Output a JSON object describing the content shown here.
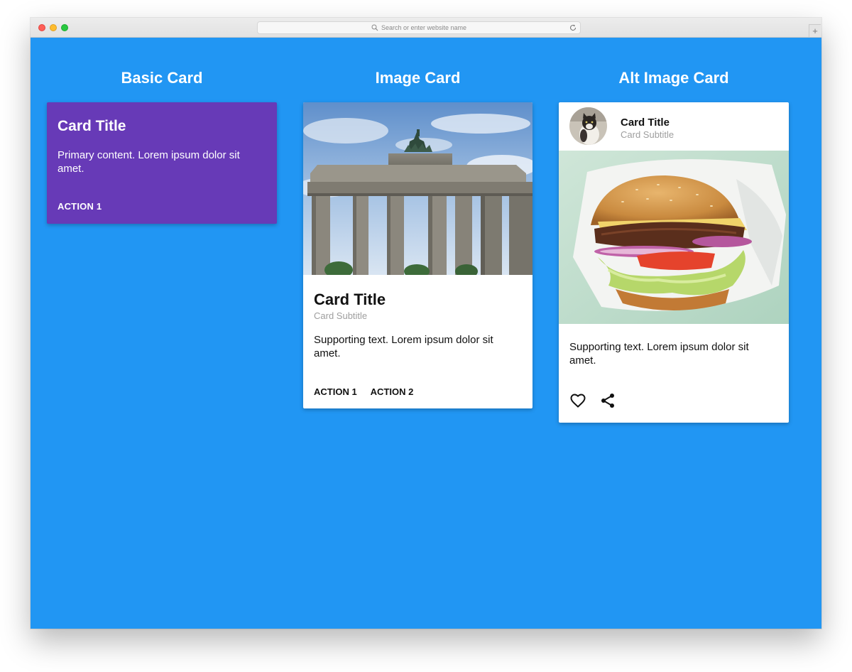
{
  "browser": {
    "address_placeholder": "Search or enter website name",
    "new_tab_label": "+"
  },
  "columns": {
    "basic": {
      "heading": "Basic Card"
    },
    "image": {
      "heading": "Image Card"
    },
    "alt": {
      "heading": "Alt Image Card"
    }
  },
  "basic_card": {
    "title": "Card Title",
    "content": "Primary content. Lorem ipsum dolor sit amet.",
    "action_1": "ACTION 1",
    "color": "#673ab7"
  },
  "image_card": {
    "title": "Card Title",
    "subtitle": "Card Subtitle",
    "supporting_text": "Supporting text. Lorem ipsum dolor sit amet.",
    "action_1": "ACTION 1",
    "action_2": "ACTION 2"
  },
  "alt_image_card": {
    "title": "Card Title",
    "subtitle": "Card Subtitle",
    "supporting_text": "Supporting text. Lorem ipsum dolor sit amet.",
    "icons": [
      "heart-icon",
      "share-icon"
    ]
  },
  "colors": {
    "background": "#2196f3",
    "card": "#ffffff",
    "basic_card": "#673ab7"
  }
}
